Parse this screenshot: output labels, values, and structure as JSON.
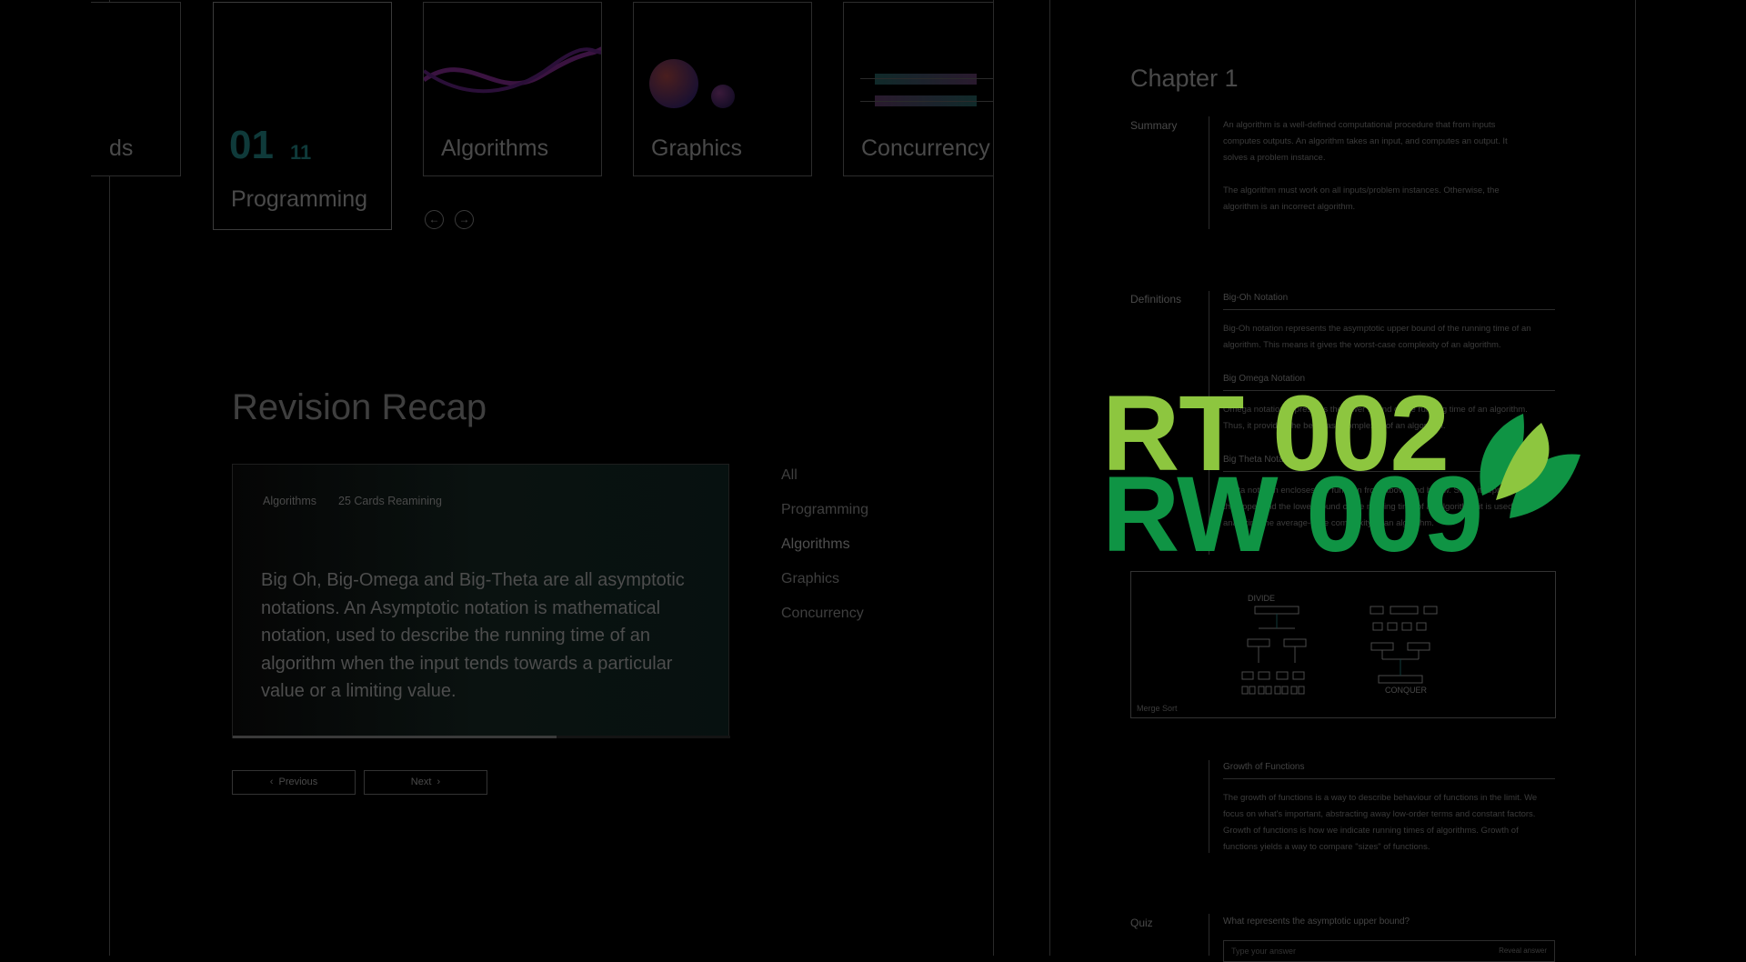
{
  "categories": {
    "items": [
      {
        "label": "ds"
      },
      {
        "label": "Programming",
        "digits_big": "01",
        "digits_small": "11"
      },
      {
        "label": "Algorithms"
      },
      {
        "label": "Graphics"
      },
      {
        "label": "Concurrency"
      }
    ],
    "prev_icon": "arrow-left-icon",
    "next_icon": "arrow-right-icon"
  },
  "recap": {
    "title": "Revision Recap",
    "card": {
      "category": "Algorithms",
      "remaining": "25 Cards Reamining",
      "body": "Big Oh, Big-Omega and Big-Theta are all asymptotic notations. An Asymptotic notation is mathematical notation, used to describe the running time of an algorithm when the input tends towards a particular value or a limiting value.",
      "progress": 0.65
    },
    "previous_label": "Previous",
    "next_label": "Next"
  },
  "filters": [
    "All",
    "Programming",
    "Algorithms",
    "Graphics",
    "Concurrency"
  ],
  "chapter": {
    "title": "Chapter 1",
    "summary_label": "Summary",
    "summary_p1": "An algorithm is a well-defined computational procedure that from inputs computes outputs. An algorithm takes an input, and computes an output. It solves a problem instance.",
    "summary_p2": "The algorithm must work on all inputs/problem instances. Otherwise, the algorithm is an incorrect algorithm.",
    "definitions_label": "Definitions",
    "def1_title": "Big-Oh Notation",
    "def1_text": "Big-Oh notation represents the asymptotic upper bound of the running time of an algorithm. This means it gives the worst-case complexity of an algorithm.",
    "def2_title": "Big Omega Notation",
    "def2_text": "Omega notation represents the lower bound of the running time of an algorithm. Thus, it provides the best case complexity of an algorithm.",
    "def3_title": "Big Theta Notation",
    "def3_text": "Theta notation encloses the function from above and below. Since it represents the upper and the lower bound of the running time of an algorithm, it is used for analyzing the average-case complexity of an algorithm.",
    "diagram_divide": "DIVIDE",
    "diagram_conquer": "CONQUER",
    "diagram_caption": "Merge Sort",
    "growth_title": "Growth of Functions",
    "growth_text": "The growth of functions is a way to describe behaviour of functions in the limit. We focus on what's important, abstracting away low-order terms and constant factors. Growth of functions is how we indicate running times of algorithms. Growth of functions yields a way to compare \"sizes\" of functions.",
    "quiz_label": "Quiz",
    "quiz_question": "What represents the asymptotic upper bound?",
    "quiz_placeholder": "Type your answer",
    "reveal_label": "Reveal answer"
  },
  "watermark": {
    "line1": "RT 002",
    "line2": "RW 009",
    "color1": "#8dc63f",
    "color2": "#0f9444",
    "icon": "leaf-icon"
  }
}
